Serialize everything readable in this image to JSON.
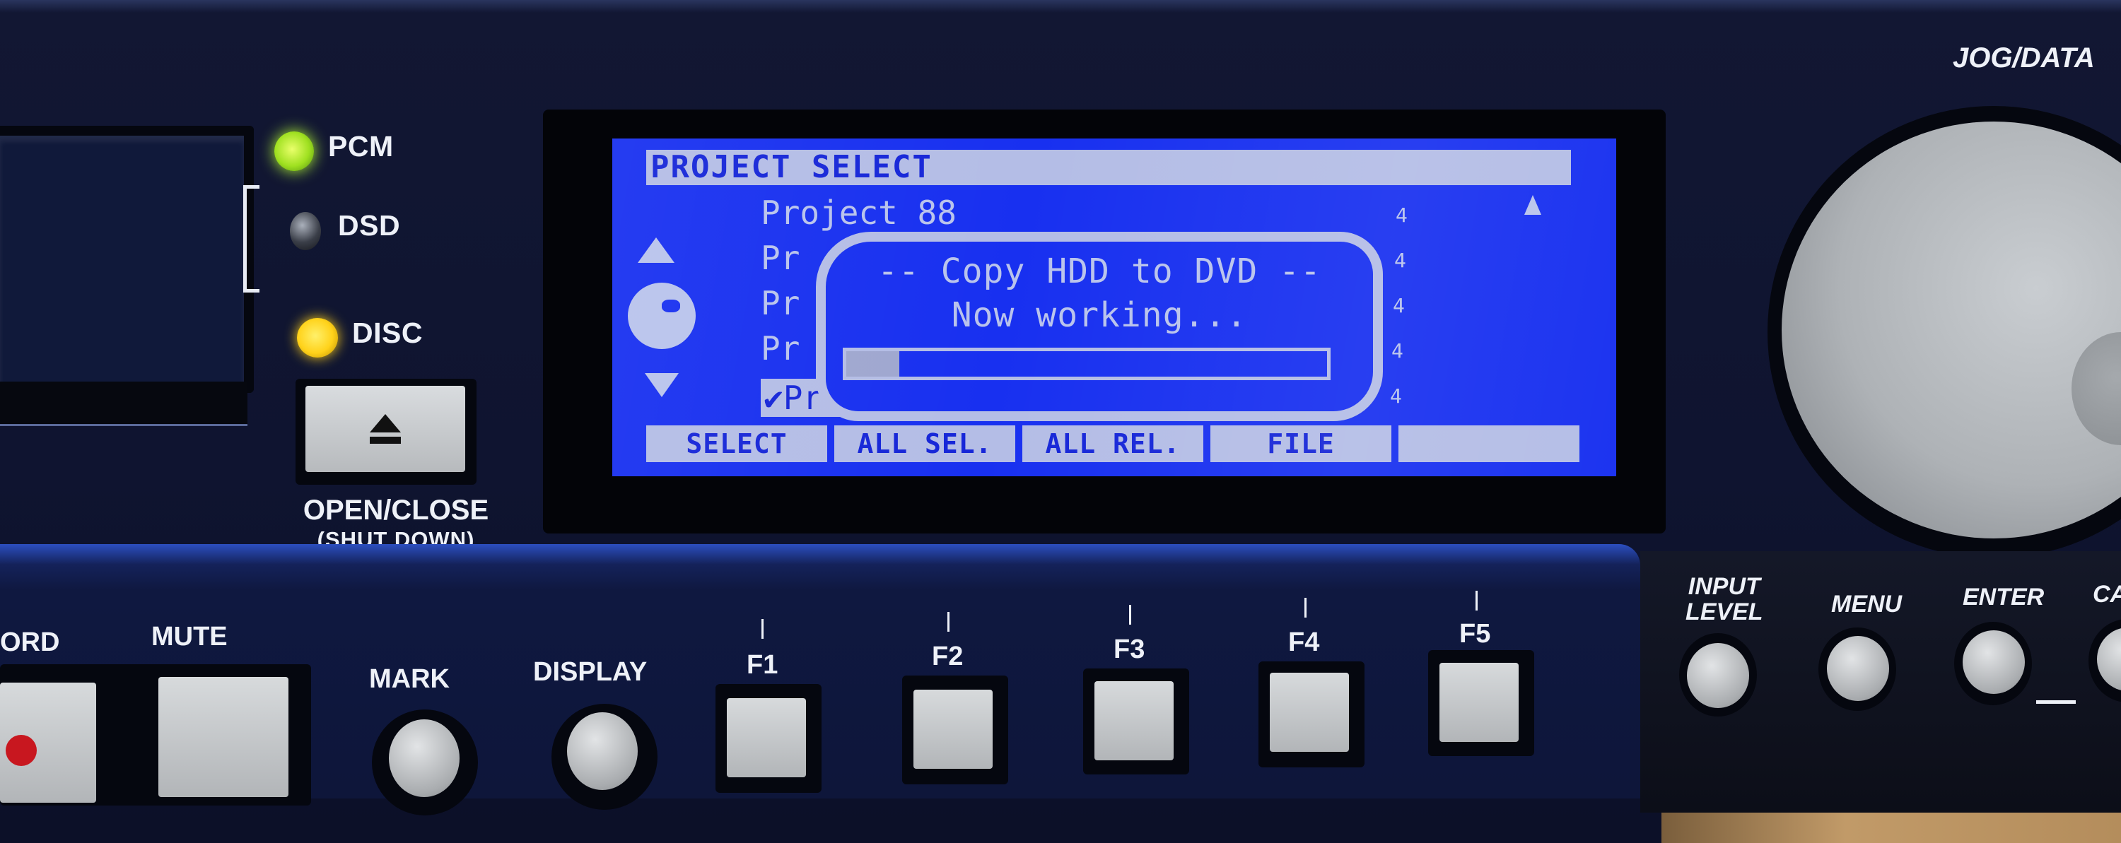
{
  "device": {
    "indicators": [
      {
        "label": "PCM",
        "state": "on",
        "color": "#a8f02a"
      },
      {
        "label": "DSD",
        "state": "off",
        "color": "#3a3e48"
      },
      {
        "label": "DISC",
        "state": "on",
        "color": "#ffd21a"
      }
    ],
    "eject": {
      "label": "OPEN/CLOSE",
      "sublabel": "(SHUT DOWN)"
    },
    "jog": {
      "label": "JOG/DATA"
    },
    "transport_buttons": [
      {
        "label": "ORD"
      },
      {
        "label": "MUTE"
      }
    ],
    "round_buttons": [
      {
        "label": "MARK"
      },
      {
        "label": "DISPLAY"
      }
    ],
    "function_keys": [
      {
        "label": "F1"
      },
      {
        "label": "F2"
      },
      {
        "label": "F3"
      },
      {
        "label": "F4"
      },
      {
        "label": "F5"
      }
    ],
    "right_buttons": [
      {
        "label_line1": "INPUT",
        "label_line2": "LEVEL"
      },
      {
        "label_line1": "MENU",
        "label_line2": ""
      },
      {
        "label_line1": "ENTER",
        "label_line2": ""
      },
      {
        "label_line1": "CA",
        "label_line2": ""
      }
    ]
  },
  "lcd": {
    "title": "PROJECT SELECT",
    "list": [
      {
        "text": "Project 88",
        "meta": "4"
      },
      {
        "text": "Pr",
        "meta": "4"
      },
      {
        "text": "Pr",
        "meta": "4"
      },
      {
        "text": "Pr",
        "meta": "4"
      },
      {
        "text": "✔Pr",
        "meta": "4",
        "selected": true
      }
    ],
    "dialog": {
      "title": "-- Copy HDD to DVD --",
      "message": "Now working...",
      "progress_percent": 11
    },
    "softkeys": [
      "SELECT",
      "ALL SEL.",
      "ALL REL.",
      "FILE",
      ""
    ],
    "colors": {
      "background": "#1830f0",
      "foreground": "#b9c3ec"
    }
  }
}
